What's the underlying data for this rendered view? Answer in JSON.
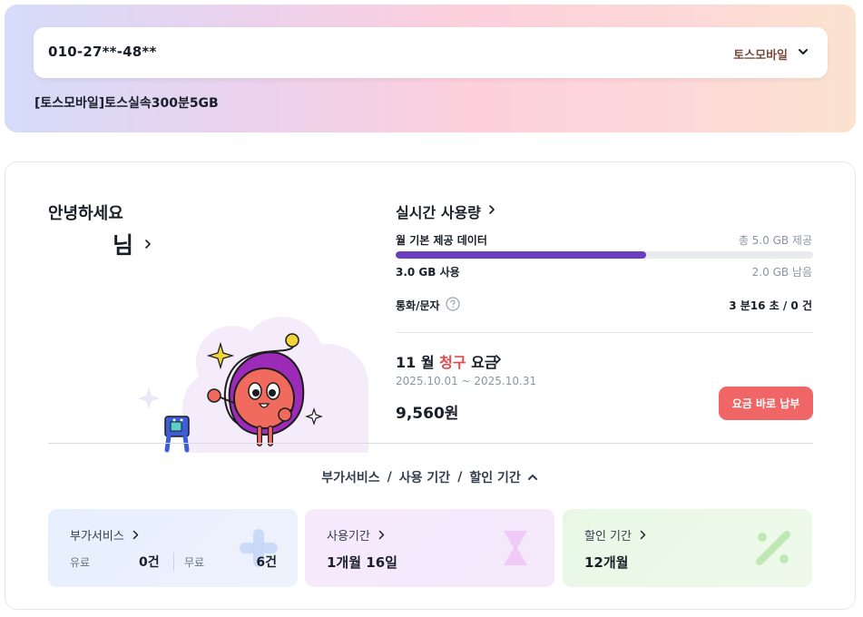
{
  "account": {
    "phone_number": "010-27**-48**",
    "carrier": "토스모바일",
    "plan_name": "[토스모바일]토스실속300분5GB"
  },
  "greeting": {
    "hello": "안녕하세요",
    "username": "님"
  },
  "realtime": {
    "title": "실시간 사용량",
    "data_label": "월 기본 제공 데이터",
    "data_total": "총 5.0 GB 제공",
    "data_used": "3.0 GB 사용",
    "data_remaining": "2.0 GB 남음",
    "data_usage_fraction": 0.6,
    "call_label": "통화/문자",
    "call_value": "3 분16 초 / 0 건"
  },
  "billing": {
    "title_month": "11 월",
    "title_highlight": "청구",
    "title_suffix": "요금",
    "period": "2025.10.01 ~ 2025.10.31",
    "amount": "9,560원",
    "pay_button": "요금 바로 납부"
  },
  "section_toggle": {
    "item1": "부가서비스",
    "item2": "사용 기간",
    "item3": "할인 기간",
    "separator": "/"
  },
  "boxes": {
    "addon": {
      "title": "부가서비스",
      "paid_label": "유료",
      "paid_value": "0건",
      "free_label": "무료",
      "free_value": "6건"
    },
    "usage": {
      "title": "사용기간",
      "value": "1개월 16일"
    },
    "discount": {
      "title": "할인 기간",
      "value": "12개월"
    }
  },
  "colors": {
    "progress": "#6a3fbf",
    "pay_button": "#f06565",
    "highlight_red": "#e5484d"
  }
}
